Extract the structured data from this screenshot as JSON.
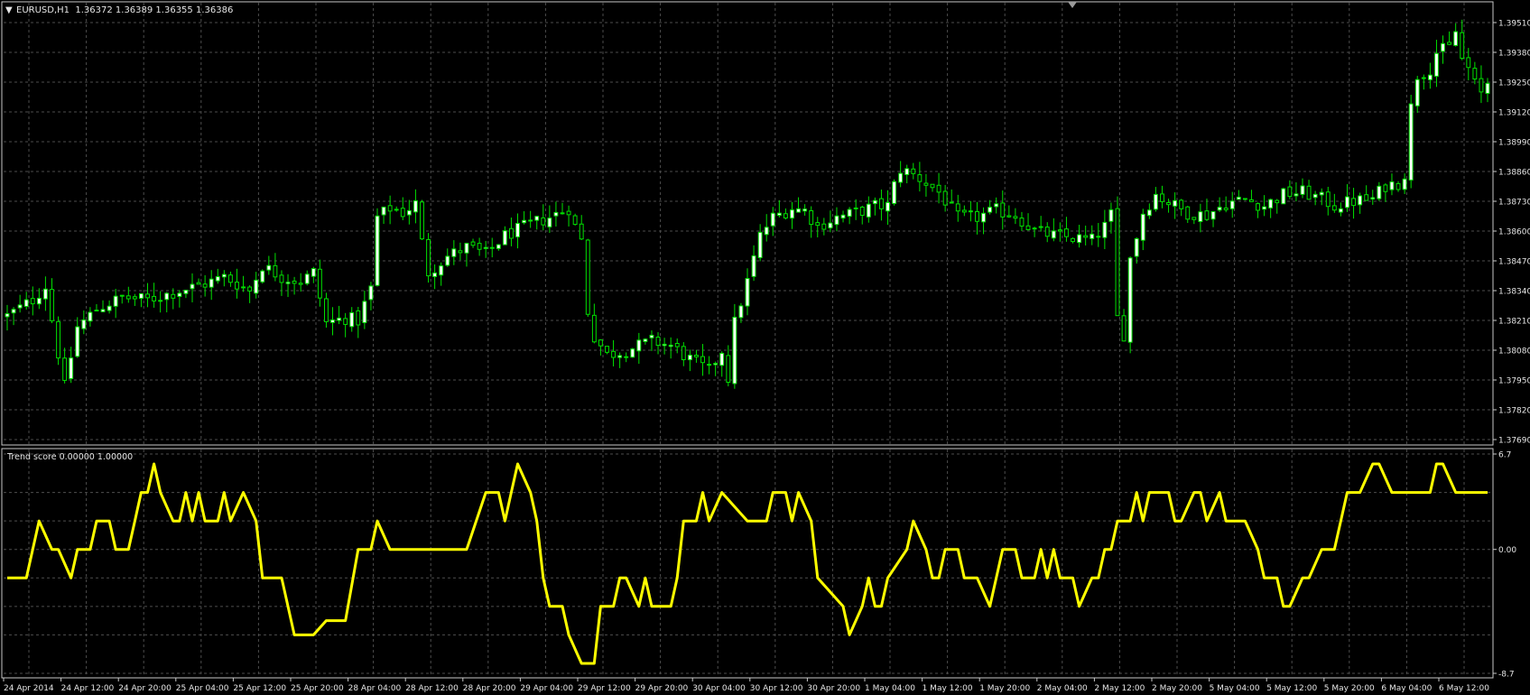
{
  "colors": {
    "background": "#000000",
    "grid": "#4d4d4d",
    "frame": "#c8c8c8",
    "text": "#e6e6e6",
    "candle_up": "#ffffff",
    "candle_down": "#000000",
    "wick": "#00e000",
    "trend_line": "#ffff00"
  },
  "price_panel": {
    "header_arrow": "▼",
    "header_text": "EURUSD,H1  1.36372 1.36389 1.36355 1.36386"
  },
  "trend_panel": {
    "header_text": "Trend score 0.00000 1.00000"
  },
  "chart_data": [
    {
      "type": "candlestick",
      "symbol": "EURUSD",
      "timeframe": "H1",
      "ohlc_header": [
        1.36372,
        1.36389,
        1.36355,
        1.36386
      ],
      "ylim": [
        1.3769,
        1.3957
      ],
      "y_ticks": [
        "1.39510",
        "1.39380",
        "1.39250",
        "1.39120",
        "1.38990",
        "1.38860",
        "1.38730",
        "1.38600",
        "1.38470",
        "1.38340",
        "1.38210",
        "1.38080",
        "1.37950",
        "1.37820",
        "1.37690"
      ],
      "x_ticks": [
        "24 Apr 2014",
        "24 Apr 12:00",
        "24 Apr 20:00",
        "25 Apr 04:00",
        "25 Apr 12:00",
        "25 Apr 20:00",
        "28 Apr 04:00",
        "28 Apr 12:00",
        "28 Apr 20:00",
        "29 Apr 04:00",
        "29 Apr 12:00",
        "29 Apr 20:00",
        "30 Apr 04:00",
        "30 Apr 12:00",
        "30 Apr 20:00",
        "1 May 04:00",
        "1 May 12:00",
        "1 May 20:00",
        "2 May 04:00",
        "2 May 12:00",
        "2 May 20:00",
        "5 May 04:00",
        "5 May 12:00",
        "5 May 20:00",
        "6 May 04:00",
        "6 May 12:00"
      ],
      "close_path": [
        [
          0,
          1.3823
        ],
        [
          4,
          1.383
        ],
        [
          6,
          1.3836
        ],
        [
          9,
          1.3792
        ],
        [
          11,
          1.3818
        ],
        [
          14,
          1.3826
        ],
        [
          18,
          1.3831
        ],
        [
          22,
          1.383
        ],
        [
          27,
          1.3834
        ],
        [
          31,
          1.3837
        ],
        [
          34,
          1.384
        ],
        [
          38,
          1.3834
        ],
        [
          40,
          1.3845
        ],
        [
          43,
          1.384
        ],
        [
          46,
          1.3838
        ],
        [
          48,
          1.3842
        ],
        [
          50,
          1.382
        ],
        [
          53,
          1.3822
        ],
        [
          55,
          1.3821
        ],
        [
          57,
          1.3835
        ],
        [
          58,
          1.3866
        ],
        [
          60,
          1.387
        ],
        [
          62,
          1.3868
        ],
        [
          64,
          1.3872
        ],
        [
          65,
          1.3855
        ],
        [
          66,
          1.3842
        ],
        [
          69,
          1.3849
        ],
        [
          72,
          1.3853
        ],
        [
          75,
          1.385
        ],
        [
          78,
          1.3858
        ],
        [
          82,
          1.3863
        ],
        [
          85,
          1.3866
        ],
        [
          88,
          1.387
        ],
        [
          89,
          1.3862
        ],
        [
          90,
          1.3856
        ],
        [
          91,
          1.3825
        ],
        [
          92,
          1.3814
        ],
        [
          94,
          1.3806
        ],
        [
          97,
          1.3808
        ],
        [
          101,
          1.3812
        ],
        [
          104,
          1.381
        ],
        [
          107,
          1.3804
        ],
        [
          110,
          1.3799
        ],
        [
          112,
          1.3808
        ],
        [
          113,
          1.3796
        ],
        [
          114,
          1.382
        ],
        [
          116,
          1.3838
        ],
        [
          118,
          1.3858
        ],
        [
          120,
          1.3866
        ],
        [
          123,
          1.387
        ],
        [
          125,
          1.3869
        ],
        [
          127,
          1.3862
        ],
        [
          130,
          1.3866
        ],
        [
          133,
          1.3868
        ],
        [
          136,
          1.3871
        ],
        [
          138,
          1.3871
        ],
        [
          139,
          1.388
        ],
        [
          140,
          1.3887
        ],
        [
          141,
          1.3886
        ],
        [
          143,
          1.3883
        ],
        [
          146,
          1.3877
        ],
        [
          149,
          1.3866
        ],
        [
          152,
          1.3866
        ],
        [
          155,
          1.3869
        ],
        [
          158,
          1.3867
        ],
        [
          161,
          1.386
        ],
        [
          164,
          1.3858
        ],
        [
          167,
          1.3857
        ],
        [
          170,
          1.3856
        ],
        [
          172,
          1.3862
        ],
        [
          173,
          1.3867
        ],
        [
          174,
          1.3822
        ],
        [
          175,
          1.3815
        ],
        [
          176,
          1.3848
        ],
        [
          178,
          1.3868
        ],
        [
          180,
          1.3876
        ],
        [
          183,
          1.3871
        ],
        [
          185,
          1.3868
        ],
        [
          188,
          1.3867
        ],
        [
          191,
          1.3872
        ],
        [
          194,
          1.3874
        ],
        [
          197,
          1.3871
        ],
        [
          200,
          1.3876
        ],
        [
          203,
          1.3877
        ],
        [
          206,
          1.3874
        ],
        [
          208,
          1.3871
        ],
        [
          211,
          1.3873
        ],
        [
          214,
          1.3874
        ],
        [
          216,
          1.388
        ],
        [
          218,
          1.3881
        ],
        [
          219,
          1.3885
        ],
        [
          220,
          1.3914
        ],
        [
          221,
          1.3928
        ],
        [
          223,
          1.3931
        ],
        [
          224,
          1.3938
        ],
        [
          226,
          1.394
        ],
        [
          227,
          1.3947
        ],
        [
          228,
          1.3935
        ],
        [
          229,
          1.3931
        ],
        [
          230,
          1.3924
        ],
        [
          231,
          1.392
        ],
        [
          232,
          1.3925
        ]
      ]
    },
    {
      "type": "line",
      "name": "Trend score",
      "y_ticks": [
        "6.7",
        "0.00",
        "-8.7"
      ],
      "ylim": [
        -8.7,
        6.7
      ],
      "x": [
        0,
        3,
        5,
        7,
        8,
        10,
        11,
        12,
        13,
        14,
        16,
        17,
        18,
        19,
        20,
        21,
        22,
        23,
        24,
        26,
        27,
        28,
        29,
        30,
        31,
        32,
        33,
        34,
        35,
        37,
        39,
        40,
        43,
        45,
        48,
        50,
        53,
        55,
        57,
        58,
        60,
        61,
        62,
        63,
        65,
        68,
        72,
        75,
        77,
        78,
        79,
        80,
        82,
        83,
        84,
        85,
        87,
        88,
        90,
        92,
        93,
        95,
        96,
        97,
        99,
        100,
        101,
        102,
        103,
        104,
        105,
        106,
        108,
        109,
        110,
        112,
        116,
        118,
        119,
        120,
        121,
        122,
        123,
        124,
        126,
        127,
        131,
        132,
        134,
        135,
        136,
        137,
        138,
        141,
        142,
        144,
        145,
        146,
        147,
        149,
        150,
        152,
        154,
        155,
        156,
        158,
        159,
        161,
        162,
        163,
        164,
        165,
        167,
        168,
        170,
        171,
        172,
        173,
        174,
        176,
        177,
        178,
        179,
        180,
        182,
        183,
        184,
        186,
        187,
        188,
        190,
        191,
        192,
        193,
        194,
        196,
        197,
        199,
        200,
        201,
        203,
        204,
        206,
        208,
        210,
        212,
        214,
        215,
        217,
        218,
        219,
        220,
        221,
        223,
        224,
        225,
        227,
        228,
        230,
        232
      ],
      "values": [
        -2,
        -2,
        2,
        0,
        0,
        -2,
        0,
        0,
        0,
        2,
        2,
        0,
        0,
        0,
        2,
        4,
        4,
        6,
        4,
        2,
        2,
        4,
        2,
        4,
        2,
        2,
        2,
        4,
        2,
        4,
        2,
        -2,
        -2,
        -6,
        -6,
        -5,
        -5,
        0,
        0,
        2,
        0,
        0,
        0,
        0,
        0,
        0,
        0,
        4,
        4,
        2,
        4,
        6,
        4,
        2,
        -2,
        -4,
        -4,
        -6,
        -8,
        -8,
        -4,
        -4,
        -2,
        -2,
        -4,
        -2,
        -4,
        -4,
        -4,
        -4,
        -2,
        2,
        2,
        4,
        2,
        4,
        2,
        2,
        2,
        4,
        4,
        4,
        2,
        4,
        2,
        -2,
        -4,
        -6,
        -4,
        -2,
        -4,
        -4,
        -2,
        0,
        2,
        0,
        -2,
        -2,
        0,
        0,
        -2,
        -2,
        -4,
        -2,
        0,
        0,
        -2,
        -2,
        0,
        -2,
        0,
        -2,
        -2,
        -4,
        -2,
        -2,
        0,
        0,
        2,
        2,
        4,
        2,
        4,
        4,
        4,
        2,
        2,
        4,
        4,
        2,
        4,
        2,
        2,
        2,
        2,
        0,
        -2,
        -2,
        -4,
        -4,
        -2,
        -2,
        0,
        0,
        4,
        4,
        6,
        6,
        4,
        4,
        4,
        4,
        4,
        4,
        6,
        6,
        4,
        4,
        4,
        4
      ]
    }
  ]
}
